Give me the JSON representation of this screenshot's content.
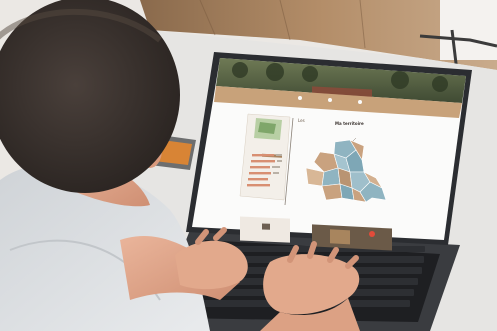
{
  "photo": {
    "subject": "person-typing-on-laptop",
    "screen": {
      "header_nav": [
        "",
        "",
        ""
      ],
      "map_title_prefix": "Les",
      "map_title_bold": "Ma territoire",
      "map_callout": "",
      "side_panel_heading": ""
    },
    "colors": {
      "wall": "#ebe8e4",
      "wood_floor": "#a57f5c",
      "desk": "#e6e5e3",
      "laptop_body": "#2b2d31",
      "screen_white": "#fbfbfa",
      "header_tan": "#c8a27a",
      "map_blue": "#8fb4c1",
      "map_tan": "#c9a27f",
      "skin": "#e2a98c",
      "hair": "#3b3330"
    }
  }
}
